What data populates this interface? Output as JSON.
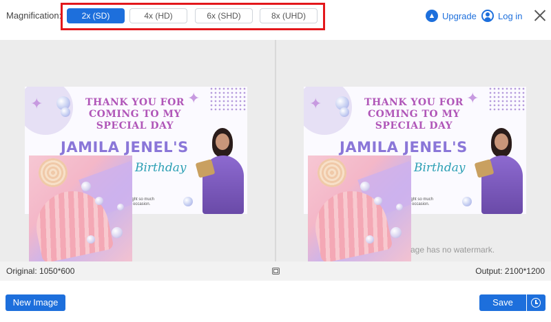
{
  "magnification": {
    "label": "Magnification:",
    "options": [
      {
        "label": "2x (SD)",
        "selected": true
      },
      {
        "label": "4x (HD)",
        "selected": false
      },
      {
        "label": "6x (SHD)",
        "selected": false
      },
      {
        "label": "8x (UHD)",
        "selected": false
      }
    ],
    "highlight_color": "#e3171b"
  },
  "header": {
    "upgrade_label": "Upgrade",
    "upgrade_icon": "arrow-up-circle-icon",
    "login_label": "Log in",
    "login_icon": "user-circle-icon",
    "close_icon": "close-icon"
  },
  "preview": {
    "card": {
      "thanks_text": "THANK YOU FOR COMING TO MY SPECIAL DAY",
      "name_text": "JAMILA JENEL'S",
      "birthday_text": "Birthday",
      "small_text_1": "ught so much",
      "small_text_2": "e occasion."
    },
    "watermark_note": "age has no watermark."
  },
  "info": {
    "original": "Original: 1050*600",
    "output": "Output: 2100*1200",
    "fit_icon": "fit-screen-icon"
  },
  "footer": {
    "new_image_label": "New Image",
    "save_label": "Save",
    "history_icon": "clock-icon"
  },
  "colors": {
    "accent": "#1d6fdc",
    "compare_bg": "#ececec"
  }
}
